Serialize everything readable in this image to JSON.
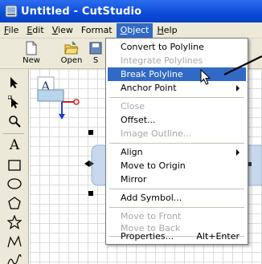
{
  "window": {
    "title": "Untitled - CutStudio"
  },
  "menubar": {
    "items": [
      {
        "label": "File"
      },
      {
        "label": "Edit"
      },
      {
        "label": "View"
      },
      {
        "label": "Format"
      },
      {
        "label": "Object"
      },
      {
        "label": "Help"
      }
    ]
  },
  "toolbar": {
    "buttons": [
      {
        "label": "New",
        "icon": "new-document-icon"
      },
      {
        "label": "Open",
        "icon": "open-folder-icon"
      },
      {
        "label": "S",
        "icon": "save-icon"
      }
    ]
  },
  "tools": [
    {
      "icon": "select-arrow-icon"
    },
    {
      "icon": "node-edit-icon"
    },
    {
      "icon": "zoom-icon"
    },
    {
      "icon": "text-icon",
      "glyph": "A"
    },
    {
      "icon": "rectangle-icon"
    },
    {
      "icon": "ellipse-icon"
    },
    {
      "icon": "pentagon-icon"
    },
    {
      "icon": "star-icon"
    },
    {
      "icon": "polyline-icon"
    },
    {
      "icon": "freehand-icon"
    }
  ],
  "object_menu": {
    "items": [
      {
        "label": "Convert to Polyline",
        "enabled": true
      },
      {
        "label": "Integrate Polylines",
        "enabled": false
      },
      {
        "label": "Break Polyline",
        "enabled": true,
        "highlighted": true
      },
      {
        "label": "Anchor Point",
        "enabled": true,
        "submenu": true
      },
      {
        "label": "Close",
        "enabled": false
      },
      {
        "label": "Offset...",
        "enabled": true
      },
      {
        "label": "Image Outline...",
        "enabled": false
      },
      {
        "label": "Align",
        "enabled": true,
        "submenu": true
      },
      {
        "label": "Move to Origin",
        "enabled": true
      },
      {
        "label": "Mirror",
        "enabled": true
      },
      {
        "label": "Add Symbol...",
        "enabled": true
      },
      {
        "label": "Move to Front",
        "enabled": false
      },
      {
        "label": "Move to Back",
        "enabled": false
      },
      {
        "label": "Properties...",
        "enabled": true,
        "shortcut": "Alt+Enter"
      }
    ]
  },
  "colors": {
    "titlebar": "#0a4bd8",
    "menu_highlight": "#316ac5",
    "chrome": "#ece9d8",
    "disabled_text": "#a7a7a7",
    "selection_red": "#d41c1c",
    "selection_blue": "#1c3fd4"
  }
}
